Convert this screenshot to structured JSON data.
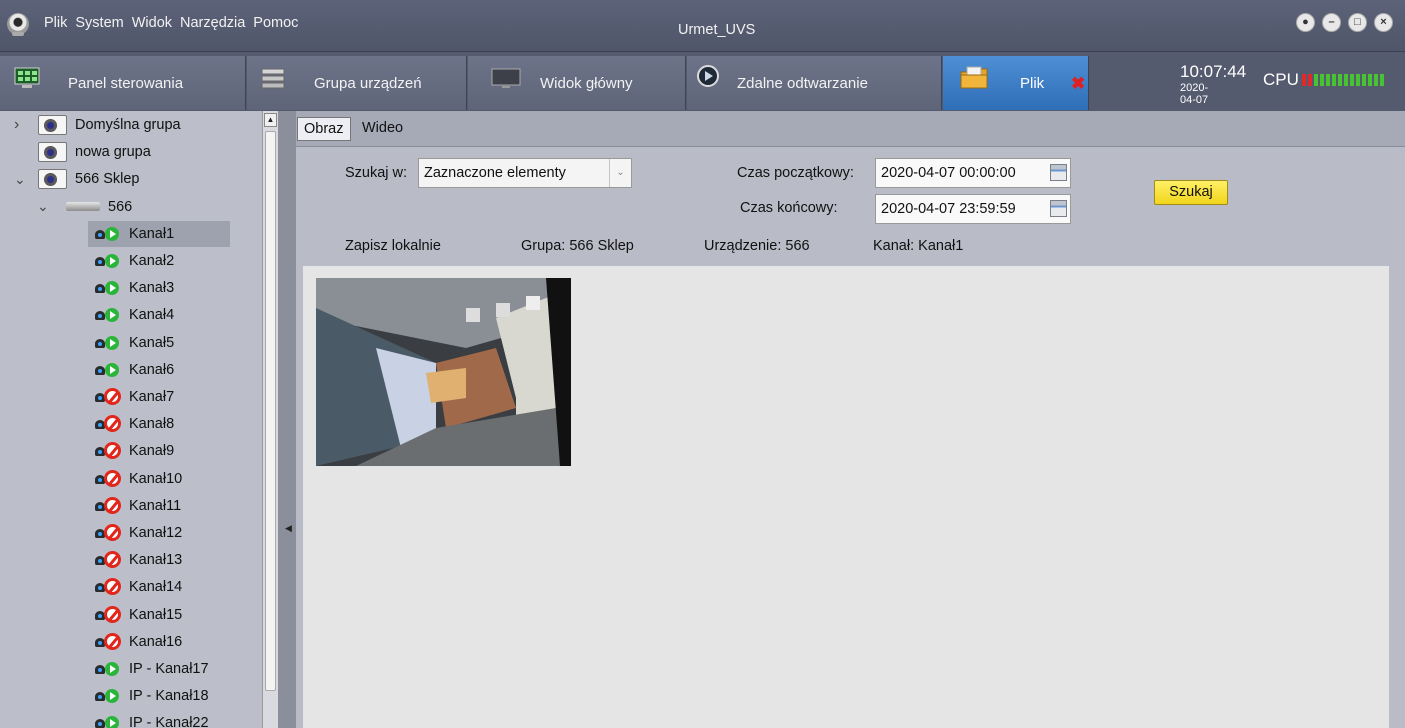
{
  "app": {
    "title": "Urmet_UVS"
  },
  "menu": [
    "Plik",
    "System",
    "Widok",
    "Narzędzia",
    "Pomoc"
  ],
  "window_controls": [
    "lock-icon",
    "minimize-icon",
    "maximize-icon",
    "close-icon"
  ],
  "tabs": [
    {
      "label": "Panel sterowania",
      "icon": "control-panel-icon"
    },
    {
      "label": "Grupa urządzeń",
      "icon": "device-group-icon"
    },
    {
      "label": "Widok główny",
      "icon": "monitor-icon"
    },
    {
      "label": "Zdalne odtwarzanie",
      "icon": "playback-icon"
    },
    {
      "label": "Plik",
      "icon": "folder-icon",
      "active": true
    }
  ],
  "status": {
    "time": "10:07:44",
    "date": "2020-04-07",
    "cpu_label": "CPU",
    "cpu_level": 0.15
  },
  "tree": {
    "groups": [
      {
        "label": "Domyślna grupa",
        "expanded": false
      },
      {
        "label": "nowa grupa",
        "expanded": false
      },
      {
        "label": "566 Sklep",
        "expanded": true
      }
    ],
    "device": {
      "label": "566"
    },
    "channels": [
      {
        "label": "Kanał1",
        "status": "ok",
        "selected": true
      },
      {
        "label": "Kanał2",
        "status": "ok"
      },
      {
        "label": "Kanał3",
        "status": "ok"
      },
      {
        "label": "Kanał4",
        "status": "ok"
      },
      {
        "label": "Kanał5",
        "status": "ok"
      },
      {
        "label": "Kanał6",
        "status": "ok"
      },
      {
        "label": "Kanał7",
        "status": "offline"
      },
      {
        "label": "Kanał8",
        "status": "offline"
      },
      {
        "label": "Kanał9",
        "status": "offline"
      },
      {
        "label": "Kanał10",
        "status": "offline"
      },
      {
        "label": "Kanał11",
        "status": "offline"
      },
      {
        "label": "Kanał12",
        "status": "offline"
      },
      {
        "label": "Kanał13",
        "status": "offline"
      },
      {
        "label": "Kanał14",
        "status": "offline"
      },
      {
        "label": "Kanał15",
        "status": "offline"
      },
      {
        "label": "Kanał16",
        "status": "offline"
      },
      {
        "label": "IP - Kanał17",
        "status": "ok"
      },
      {
        "label": "IP - Kanał18",
        "status": "ok"
      },
      {
        "label": "IP - Kanał22",
        "status": "ok"
      }
    ]
  },
  "subtabs": [
    {
      "label": "Obraz",
      "active": true
    },
    {
      "label": "Wideo"
    }
  ],
  "search": {
    "search_in_label": "Szukaj w:",
    "search_in_value": "Zaznaczone elementy",
    "start_label": "Czas początkowy:",
    "start_value": "2020-04-07 00:00:00",
    "end_label": "Czas końcowy:",
    "end_value": "2020-04-07 23:59:59",
    "search_button": "Szukaj"
  },
  "info": {
    "save_local": "Zapisz lokalnie",
    "group": "Grupa: 566 Sklep",
    "device": "Urządzenie: 566",
    "channel": "Kanał: Kanał1"
  },
  "colors": {
    "active_tab": "#3b7cc6",
    "search_button": "#f5e23a",
    "cpu_ok": "#48c232",
    "cpu_hot": "#e02a2a",
    "channel_ok": "#2ab53a",
    "channel_offline": "#e2261c"
  }
}
